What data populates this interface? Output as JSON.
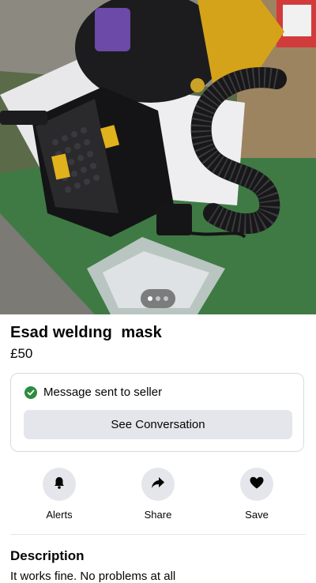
{
  "listing": {
    "title": "Esad weldıng  mask",
    "price": "£50"
  },
  "carousel": {
    "count": 3,
    "active": 0
  },
  "message_card": {
    "status_text": "Message sent to seller",
    "button_label": "See Conversation"
  },
  "actions": [
    {
      "label": "Alerts",
      "icon": "bell-icon"
    },
    {
      "label": "Share",
      "icon": "share-arrow-icon"
    },
    {
      "label": "Save",
      "icon": "heart-icon"
    }
  ],
  "description": {
    "heading": "Description",
    "text": "It works fine. No problems at all"
  },
  "colors": {
    "success": "#2e8b3e",
    "button_bg": "#e4e6eb",
    "text": "#050505"
  }
}
